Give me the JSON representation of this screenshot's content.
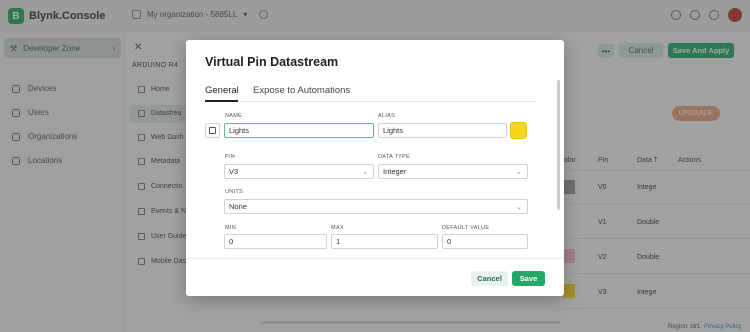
{
  "app": {
    "brand": "Blynk.Console",
    "brand_logo_letter": "B",
    "org": "My organization - 5885LL"
  },
  "sidebar": {
    "dev_zone": "Developer Zone",
    "items": [
      {
        "label": "Devices"
      },
      {
        "label": "Users"
      },
      {
        "label": "Organizations"
      },
      {
        "label": "Locations"
      }
    ]
  },
  "subnav": {
    "device": "ARDUINO R4",
    "items": [
      {
        "label": "Home"
      },
      {
        "label": "Datastrea"
      },
      {
        "label": "Web Dash"
      },
      {
        "label": "Metadata"
      },
      {
        "label": "Connectio"
      },
      {
        "label": "Events & N"
      },
      {
        "label": "User Guide"
      },
      {
        "label": "Mobile Das"
      }
    ]
  },
  "toolbar": {
    "more_label": "•••",
    "cancel_label": "Cancel",
    "save_apply_label": "Save And Apply",
    "upgrade_label": "UPGRADE"
  },
  "table": {
    "headers": {
      "color": "olor",
      "pin": "Pin",
      "data_type": "Data T",
      "actions": "Actions"
    },
    "rows": [
      {
        "pin": "V0",
        "type": "Intege",
        "color": "#9a9a9a"
      },
      {
        "pin": "V1",
        "type": "Double",
        "color": ""
      },
      {
        "pin": "V2",
        "type": "Double",
        "color": "#f4b6c2"
      },
      {
        "pin": "V3",
        "type": "Intege",
        "color": "#f7d61c"
      }
    ]
  },
  "footer": {
    "region": "Region: blr1",
    "privacy": "Privacy Policy"
  },
  "modal": {
    "title": "Virtual Pin Datastream",
    "tabs": {
      "general": "General",
      "expose": "Expose to Automations"
    },
    "fields": {
      "name_label": "NAME",
      "name_value": "Lights",
      "alias_label": "ALIAS",
      "alias_value": "Lights",
      "pin_label": "PIN",
      "pin_value": "V3",
      "data_type_label": "DATA TYPE",
      "data_type_value": "Integer",
      "units_label": "UNITS",
      "units_value": "None",
      "min_label": "MIN",
      "min_value": "0",
      "max_label": "MAX",
      "max_value": "1",
      "default_label": "DEFAULT VALUE",
      "default_value": "0"
    },
    "color": "#f7d61c",
    "cancel_label": "Cancel",
    "save_label": "Save"
  }
}
